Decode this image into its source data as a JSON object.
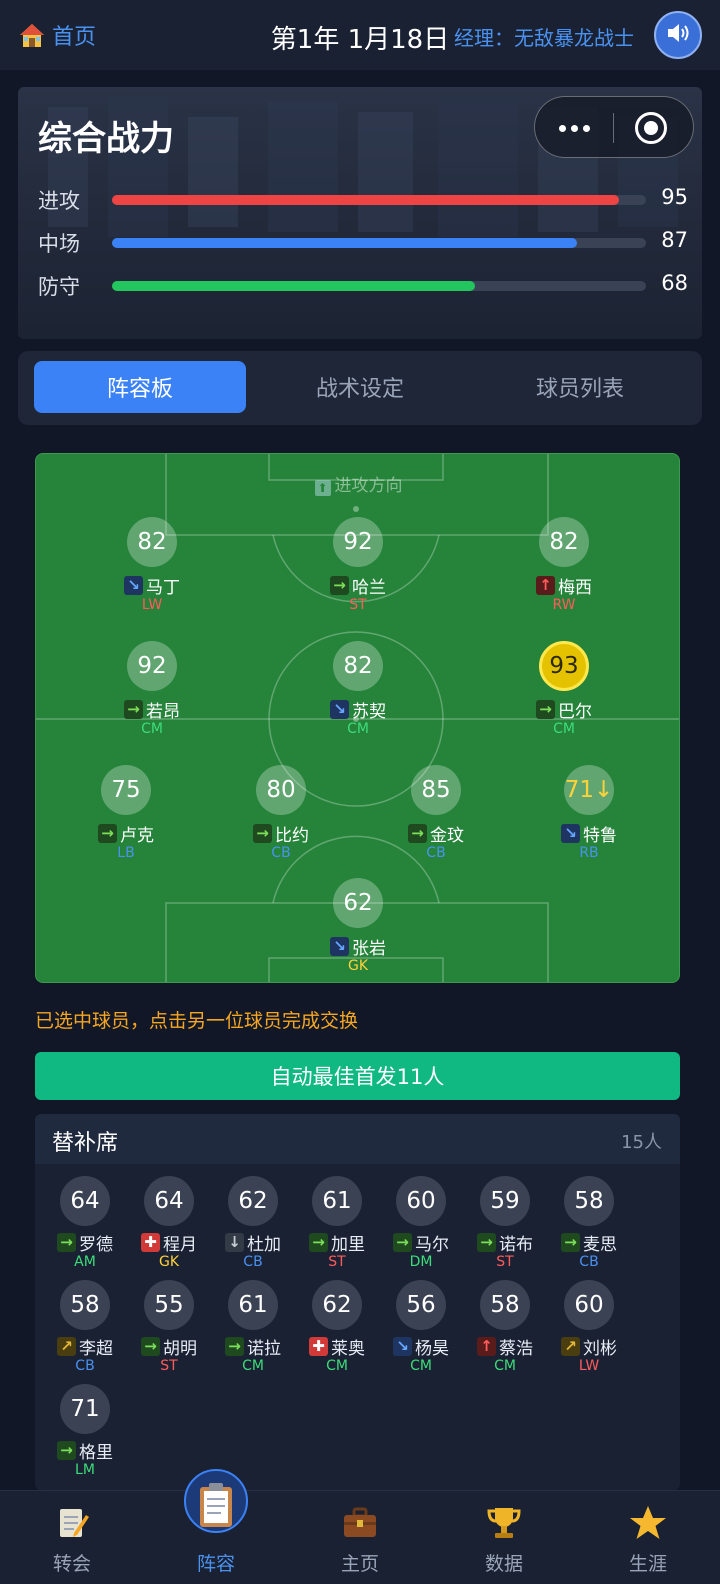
{
  "header": {
    "home_label": "首页",
    "date": "第1年 1月18日",
    "manager": "经理：无敌暴龙战士"
  },
  "power": {
    "title": "综合战力",
    "stats": [
      {
        "label": "进攻",
        "value": 95,
        "color": "#ef4444"
      },
      {
        "label": "中场",
        "value": 87,
        "color": "#3b82f6"
      },
      {
        "label": "防守",
        "value": 68,
        "color": "#22c55e"
      }
    ]
  },
  "tabs": [
    "阵容板",
    "战术设定",
    "球员列表"
  ],
  "active_tab": 0,
  "pitch": {
    "attack_direction": "进攻方向",
    "starters": [
      {
        "rating": "82",
        "name": "马丁",
        "pos": "LW",
        "trend": "down"
      },
      {
        "rating": "92",
        "name": "哈兰",
        "pos": "ST",
        "trend": "right"
      },
      {
        "rating": "82",
        "name": "梅西",
        "pos": "RW",
        "trend": "up"
      },
      {
        "rating": "92",
        "name": "若昂",
        "pos": "CM",
        "trend": "right"
      },
      {
        "rating": "82",
        "name": "苏契",
        "pos": "CM",
        "trend": "down"
      },
      {
        "rating": "93",
        "name": "巴尔",
        "pos": "CM",
        "trend": "right",
        "selected": true
      },
      {
        "rating": "75",
        "name": "卢克",
        "pos": "LB",
        "trend": "right"
      },
      {
        "rating": "80",
        "name": "比约",
        "pos": "CB",
        "trend": "right"
      },
      {
        "rating": "85",
        "name": "金玟",
        "pos": "CB",
        "trend": "right"
      },
      {
        "rating": "71↓",
        "name": "特鲁",
        "pos": "RB",
        "trend": "down",
        "warn": true
      },
      {
        "rating": "62",
        "name": "张岩",
        "pos": "GK",
        "trend": "down"
      }
    ]
  },
  "hint": "已选中球员，点击另一位球员完成交换",
  "auto_button": "自动最佳首发11人",
  "bench": {
    "title": "替补席",
    "count": "15人",
    "players": [
      {
        "rating": "64",
        "name": "罗德",
        "pos": "AM",
        "trend": "right"
      },
      {
        "rating": "64",
        "name": "程月",
        "pos": "GK",
        "trend": "injury"
      },
      {
        "rating": "62",
        "name": "杜加",
        "pos": "CB",
        "trend": "plain"
      },
      {
        "rating": "61",
        "name": "加里",
        "pos": "ST",
        "trend": "right"
      },
      {
        "rating": "60",
        "name": "马尔",
        "pos": "DM",
        "trend": "right"
      },
      {
        "rating": "59",
        "name": "诺布",
        "pos": "ST",
        "trend": "right"
      },
      {
        "rating": "58",
        "name": "麦思",
        "pos": "CB",
        "trend": "right"
      },
      {
        "rating": "58",
        "name": "李超",
        "pos": "CB",
        "trend": "upright"
      },
      {
        "rating": "55",
        "name": "胡明",
        "pos": "ST",
        "trend": "right"
      },
      {
        "rating": "61",
        "name": "诺拉",
        "pos": "CM",
        "trend": "right"
      },
      {
        "rating": "62",
        "name": "莱奥",
        "pos": "CM",
        "trend": "injury"
      },
      {
        "rating": "56",
        "name": "杨昊",
        "pos": "CM",
        "trend": "down"
      },
      {
        "rating": "58",
        "name": "蔡浩",
        "pos": "CM",
        "trend": "up"
      },
      {
        "rating": "60",
        "name": "刘彬",
        "pos": "LW",
        "trend": "upright"
      },
      {
        "rating": "71",
        "name": "格里",
        "pos": "LM",
        "trend": "right"
      }
    ]
  },
  "nav": [
    {
      "label": "转会",
      "icon": "notepad-pencil-icon"
    },
    {
      "label": "阵容",
      "icon": "clipboard-icon",
      "active": true
    },
    {
      "label": "主页",
      "icon": "briefcase-icon"
    },
    {
      "label": "数据",
      "icon": "trophy-icon"
    },
    {
      "label": "生涯",
      "icon": "star-icon"
    }
  ]
}
